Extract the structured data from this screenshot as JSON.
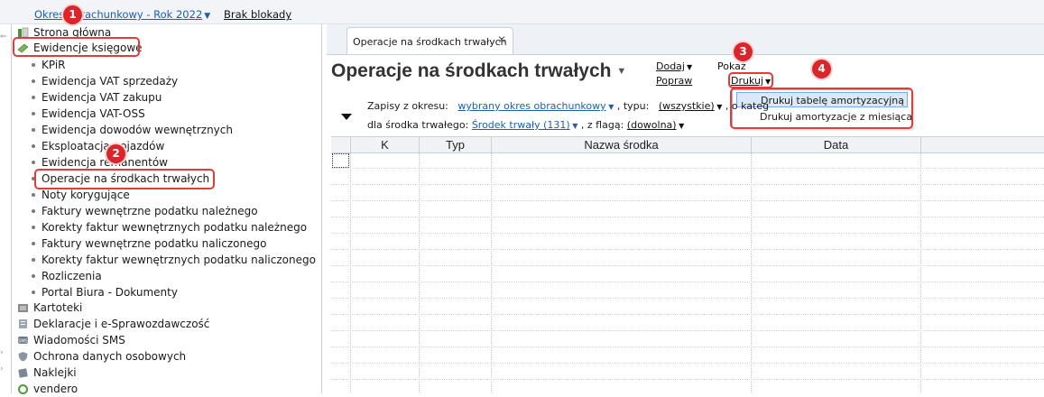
{
  "topbar": {
    "period_label": "Okres obrachunkowy - Rok 2022",
    "lock_label": "Brak blokady"
  },
  "sidebar": {
    "items": [
      {
        "label": "Strona główna",
        "icon": "home-icon"
      },
      {
        "label": "Ewidencje księgowe",
        "icon": "ledger-icon"
      }
    ],
    "sub_items": [
      "KPiR",
      "Ewidencja VAT sprzedaży",
      "Ewidencja VAT zakupu",
      "Ewidencja VAT-OSS",
      "Ewidencja dowodów wewnętrznych",
      "Eksploatacja pojazdów",
      "Ewidencja remanentów",
      "Operacje na środkach trwałych",
      "Noty korygujące",
      "Faktury wewnętrzne podatku należnego",
      "Korekty faktur wewnętrznych podatku należnego",
      "Faktury wewnętrzne podatku naliczonego",
      "Korekty faktur wewnętrznych podatku naliczonego",
      "Rozliczenia",
      "Portal Biura - Dokumenty"
    ],
    "bottom_items": [
      {
        "label": "Kartoteki",
        "icon": "cards-icon"
      },
      {
        "label": "Deklaracje i e-Sprawozdawczość",
        "icon": "declaration-icon"
      },
      {
        "label": "Wiadomości SMS",
        "icon": "sms-icon"
      },
      {
        "label": "Ochrona danych osobowych",
        "icon": "shield-icon"
      },
      {
        "label": "Naklejki",
        "icon": "sticker-icon"
      },
      {
        "label": "vendero",
        "icon": "vendero-icon"
      }
    ]
  },
  "tabs": [
    {
      "label": "Operacje na środkach trwałych"
    }
  ],
  "page": {
    "title": "Operacje na środkach trwałych",
    "actions": {
      "add": "Dodaj",
      "show": "Pokaż",
      "edit": "Popraw",
      "print": "Drukuj"
    }
  },
  "filters": {
    "records_label": "Zapisy z okresu:",
    "period_value": "wybrany okres obrachunkowy",
    "type_label": ", typu:",
    "type_value": "(wszystkie)",
    "category_label": ", o kateg",
    "asset_label": "dla środka trwałego:",
    "asset_value": "Środek trwały (131)",
    "flag_label": ", z flagą:",
    "flag_value": "(dowolna)"
  },
  "print_menu": {
    "items": [
      "Drukuj tabelę amortyzacyjną",
      "Drukuj amortyzacje z miesiąca"
    ]
  },
  "table": {
    "columns": [
      "K",
      "Typ",
      "Nazwa środka",
      "Data"
    ]
  },
  "annotations": [
    "1",
    "2",
    "3",
    "4"
  ],
  "colors": {
    "highlight": "#e23b3b",
    "badge": "#d8262c",
    "link": "#1a5fb4",
    "menu_active": "#d9e8fb"
  }
}
